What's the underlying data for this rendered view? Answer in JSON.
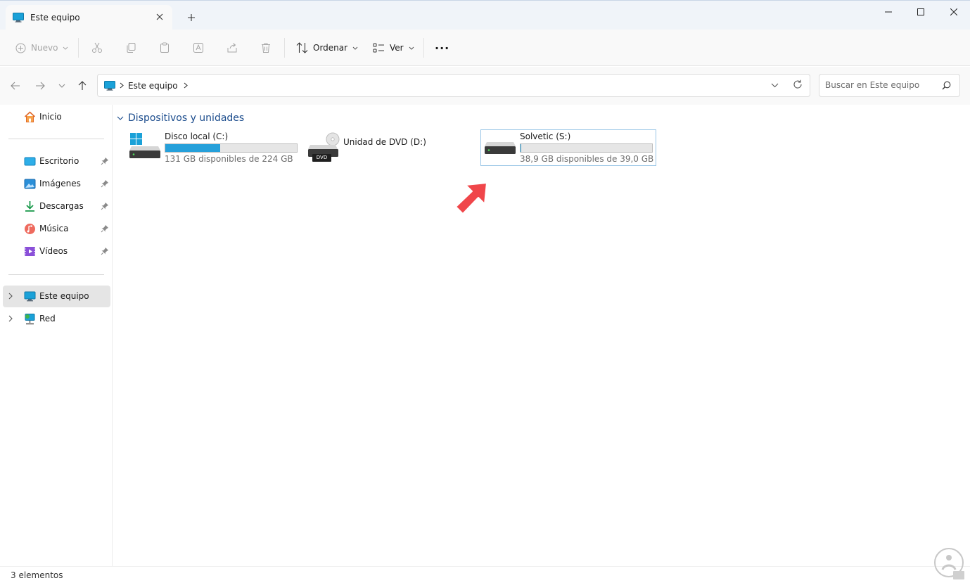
{
  "window": {
    "tab_title": "Este equipo"
  },
  "toolbar": {
    "new_label": "Nuevo",
    "sort_label": "Ordenar",
    "view_label": "Ver",
    "more_label": "···"
  },
  "address": {
    "crumb": "Este equipo"
  },
  "search": {
    "placeholder": "Buscar en Este equipo"
  },
  "sidebar": {
    "home": "Inicio",
    "pinned": [
      {
        "label": "Escritorio",
        "icon": "desktop-icon"
      },
      {
        "label": "Imágenes",
        "icon": "pictures-icon"
      },
      {
        "label": "Descargas",
        "icon": "downloads-icon"
      },
      {
        "label": "Música",
        "icon": "music-icon"
      },
      {
        "label": "Vídeos",
        "icon": "videos-icon"
      }
    ],
    "this_pc": "Este equipo",
    "network": "Red"
  },
  "main": {
    "group_title": "Dispositivos y unidades",
    "drives": [
      {
        "name": "Disco local (C:)",
        "subtitle": "131 GB disponibles de 224 GB",
        "used_fraction": 0.415
      },
      {
        "name": "Unidad de DVD (D:)",
        "dvd_label": "DVD"
      },
      {
        "name": "Solvetic (S:)",
        "subtitle": "38,9 GB disponibles de 39,0 GB",
        "used_fraction": 0.003
      }
    ]
  },
  "status": {
    "items_text": "3 elementos"
  },
  "colors": {
    "accent": "#26a0da",
    "group_header": "#1a4b8c",
    "arrow": "#f0464a"
  }
}
